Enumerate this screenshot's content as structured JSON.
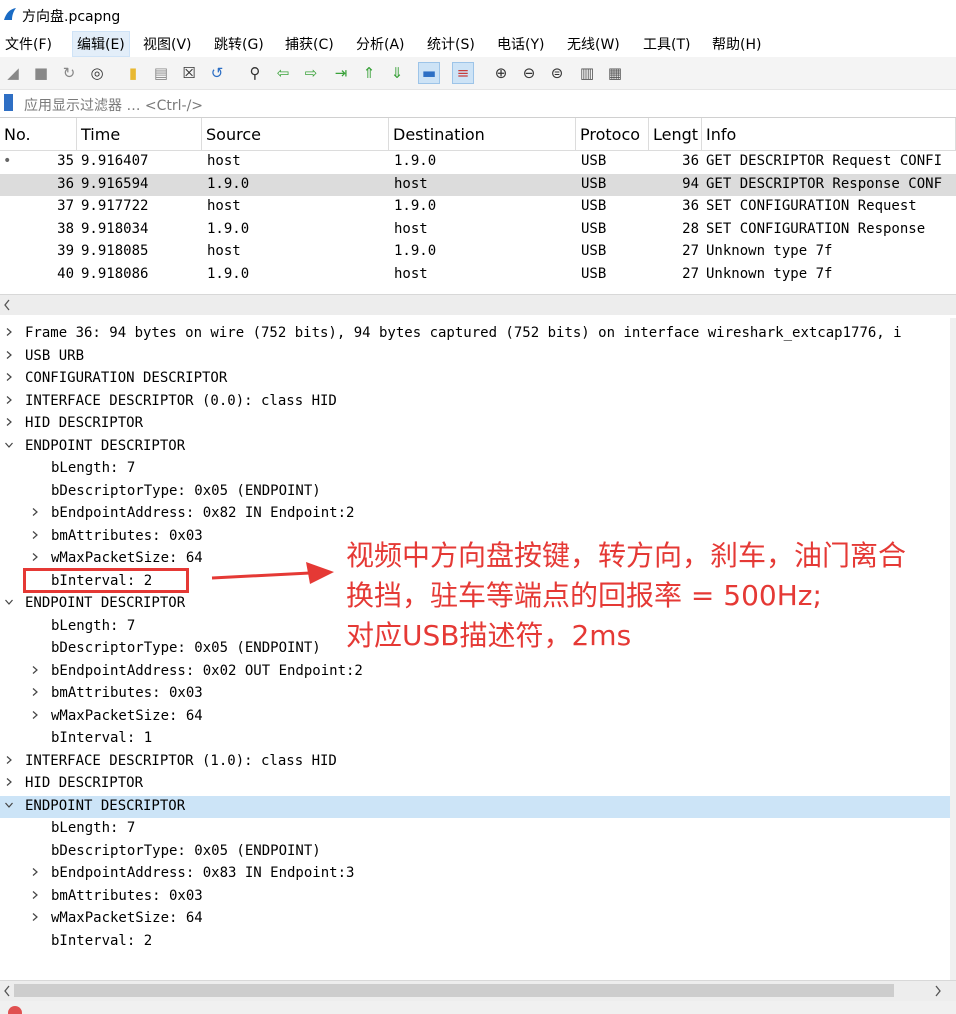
{
  "window": {
    "title": "方向盘.pcapng"
  },
  "menu": [
    "文件(F)",
    "编辑(E)",
    "视图(V)",
    "跳转(G)",
    "捕获(C)",
    "分析(A)",
    "统计(S)",
    "电话(Y)",
    "无线(W)",
    "工具(T)",
    "帮助(H)"
  ],
  "menu_active_index": 1,
  "toolbar_icons": [
    "start-capture-icon",
    "stop-capture-icon",
    "restart-capture-icon",
    "capture-options-icon",
    "open-file-icon",
    "save-file-icon",
    "close-file-icon",
    "reload-file-icon",
    "find-packet-icon",
    "go-back-icon",
    "go-forward-icon",
    "go-to-packet-icon",
    "first-packet-icon",
    "last-packet-icon",
    "autoscroll-icon",
    "colorize-icon",
    "zoom-in-icon",
    "zoom-out-icon",
    "normal-size-icon",
    "resize-columns-icon",
    "layout-icon"
  ],
  "filter": {
    "placeholder": "应用显示过滤器 … <Ctrl-/>"
  },
  "packet_list": {
    "columns": [
      "No.",
      "Time",
      "Source",
      "Destination",
      "Protoco",
      "Lengt",
      "Info"
    ],
    "rows": [
      {
        "no": "35",
        "time": "9.916407",
        "source": "host",
        "destination": "1.9.0",
        "protocol": "USB",
        "length": "36",
        "info": "GET DESCRIPTOR Request CONFI",
        "marker": "•"
      },
      {
        "no": "36",
        "time": "9.916594",
        "source": "1.9.0",
        "destination": "host",
        "protocol": "USB",
        "length": "94",
        "info": "GET DESCRIPTOR Response CONF",
        "marker": ""
      },
      {
        "no": "37",
        "time": "9.917722",
        "source": "host",
        "destination": "1.9.0",
        "protocol": "USB",
        "length": "36",
        "info": "SET CONFIGURATION Request",
        "marker": ""
      },
      {
        "no": "38",
        "time": "9.918034",
        "source": "1.9.0",
        "destination": "host",
        "protocol": "USB",
        "length": "28",
        "info": "SET CONFIGURATION Response",
        "marker": ""
      },
      {
        "no": "39",
        "time": "9.918085",
        "source": "host",
        "destination": "1.9.0",
        "protocol": "USB",
        "length": "27",
        "info": "Unknown type 7f",
        "marker": ""
      },
      {
        "no": "40",
        "time": "9.918086",
        "source": "1.9.0",
        "destination": "host",
        "protocol": "USB",
        "length": "27",
        "info": "Unknown type 7f",
        "marker": ""
      }
    ]
  },
  "details": [
    {
      "text": "Frame 36: 94 bytes on wire (752 bits), 94 bytes captured (752 bits) on interface wireshark_extcap1776, i",
      "level": 0,
      "expander": "collapsed"
    },
    {
      "text": "USB URB",
      "level": 0,
      "expander": "collapsed"
    },
    {
      "text": "CONFIGURATION DESCRIPTOR",
      "level": 0,
      "expander": "collapsed"
    },
    {
      "text": "INTERFACE DESCRIPTOR (0.0): class HID",
      "level": 0,
      "expander": "collapsed"
    },
    {
      "text": "HID DESCRIPTOR",
      "level": 0,
      "expander": "collapsed"
    },
    {
      "text": "ENDPOINT DESCRIPTOR",
      "level": 0,
      "expander": "expanded"
    },
    {
      "text": "bLength: 7",
      "level": 1,
      "expander": "none"
    },
    {
      "text": "bDescriptorType: 0x05 (ENDPOINT)",
      "level": 1,
      "expander": "none"
    },
    {
      "text": "bEndpointAddress: 0x82  IN  Endpoint:2",
      "level": 1,
      "expander": "collapsed"
    },
    {
      "text": "bmAttributes: 0x03",
      "level": 1,
      "expander": "collapsed"
    },
    {
      "text": "wMaxPacketSize: 64",
      "level": 1,
      "expander": "collapsed"
    },
    {
      "text": "bInterval: 2",
      "level": 1,
      "expander": "none",
      "highlight": true
    },
    {
      "text": "ENDPOINT DESCRIPTOR",
      "level": 0,
      "expander": "expanded"
    },
    {
      "text": "bLength: 7",
      "level": 1,
      "expander": "none"
    },
    {
      "text": "bDescriptorType: 0x05 (ENDPOINT)",
      "level": 1,
      "expander": "none"
    },
    {
      "text": "bEndpointAddress: 0x02  OUT  Endpoint:2",
      "level": 1,
      "expander": "collapsed"
    },
    {
      "text": "bmAttributes: 0x03",
      "level": 1,
      "expander": "collapsed"
    },
    {
      "text": "wMaxPacketSize: 64",
      "level": 1,
      "expander": "collapsed"
    },
    {
      "text": "bInterval: 1",
      "level": 1,
      "expander": "none"
    },
    {
      "text": "INTERFACE DESCRIPTOR (1.0): class HID",
      "level": 0,
      "expander": "collapsed"
    },
    {
      "text": "HID DESCRIPTOR",
      "level": 0,
      "expander": "collapsed"
    },
    {
      "text": "ENDPOINT DESCRIPTOR",
      "level": 0,
      "expander": "expanded",
      "selected": true
    },
    {
      "text": "bLength: 7",
      "level": 1,
      "expander": "none"
    },
    {
      "text": "bDescriptorType: 0x05 (ENDPOINT)",
      "level": 1,
      "expander": "none"
    },
    {
      "text": "bEndpointAddress: 0x83  IN  Endpoint:3",
      "level": 1,
      "expander": "collapsed"
    },
    {
      "text": "bmAttributes: 0x03",
      "level": 1,
      "expander": "collapsed"
    },
    {
      "text": "wMaxPacketSize: 64",
      "level": 1,
      "expander": "collapsed"
    },
    {
      "text": "bInterval: 2",
      "level": 1,
      "expander": "none"
    }
  ],
  "annotation": {
    "lines": [
      "视频中方向盘按键，转方向，刹车，油门离合",
      "换挡，驻车等端点的回报率 = 500Hz;",
      "对应USB描述符，2ms"
    ],
    "color": "#e53935"
  }
}
